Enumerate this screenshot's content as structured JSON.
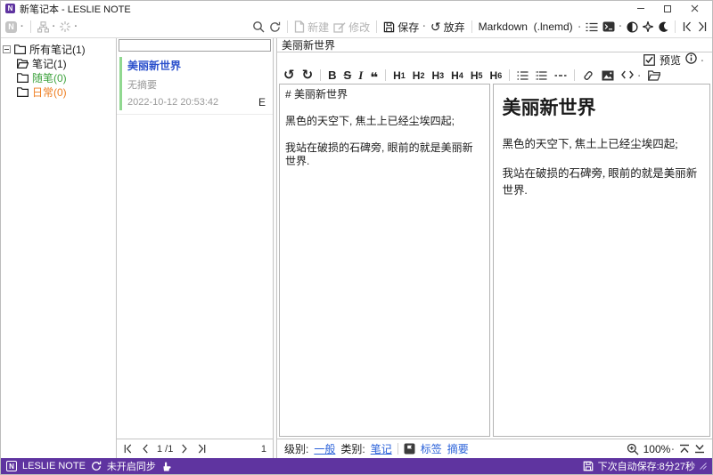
{
  "logo": {
    "letter": "N"
  },
  "titlebar": {
    "title": "新笔记本 - LESLIE NOTE"
  },
  "toolbar": {
    "new_label": "新建",
    "modify_label": "修改",
    "save_label": "保存",
    "discard_label": "放弃",
    "format_label": "Markdown  (.lnemd)"
  },
  "icons": {
    "undo": "↺",
    "redo": "↻",
    "quote": "❝"
  },
  "sidebar": {
    "items": [
      {
        "label": "所有笔记(1)"
      },
      {
        "label": "笔记(1)"
      },
      {
        "label": "随笔(0)"
      },
      {
        "label": "日常(0)"
      }
    ]
  },
  "notelist": {
    "filter_placeholder": "",
    "items": [
      {
        "title": "美丽新世界",
        "summary": "无摘要",
        "timestamp": "2022-10-12 20:53:42",
        "flag": "E"
      }
    ],
    "page_display": "1 /1",
    "count": "1"
  },
  "editor": {
    "note_title": "美丽新世界",
    "preview_label": "预览",
    "md_toolbar": {
      "bold": "B",
      "strikethrough": "S",
      "italic": "I",
      "h_prefix": "H",
      "h_nums": [
        "1",
        "2",
        "3",
        "4",
        "5",
        "6"
      ]
    },
    "source_text": "# 美丽新世界\n\n黑色的天空下, 焦土上已经尘埃四起;\n\n我站在破损的石碑旁, 眼前的就是美丽新世界.",
    "preview": {
      "heading": "美丽新世界",
      "paragraphs": [
        "黑色的天空下, 焦土上已经尘埃四起;",
        "我站在破损的石碑旁, 眼前的就是美丽新世界."
      ]
    }
  },
  "editor_bottom": {
    "level_label": "级别:",
    "level_value": "一般",
    "category_label": "类别:",
    "category_value": "笔记",
    "tags_label": "标签",
    "summary_label": "摘要",
    "zoom_level": "100%"
  },
  "statusbar": {
    "app_name": "LESLIE NOTE",
    "sync_status": "未开启同步",
    "autosave": "下次自动保存:8分27秒"
  },
  "colors": {
    "accent_purple": "#5F34A0",
    "note_title_blue": "#2B50CC",
    "link_blue": "#2B62D9",
    "folder_green": "#3FA33F",
    "folder_orange": "#EE7E21",
    "note_bar_green": "#90D890"
  }
}
